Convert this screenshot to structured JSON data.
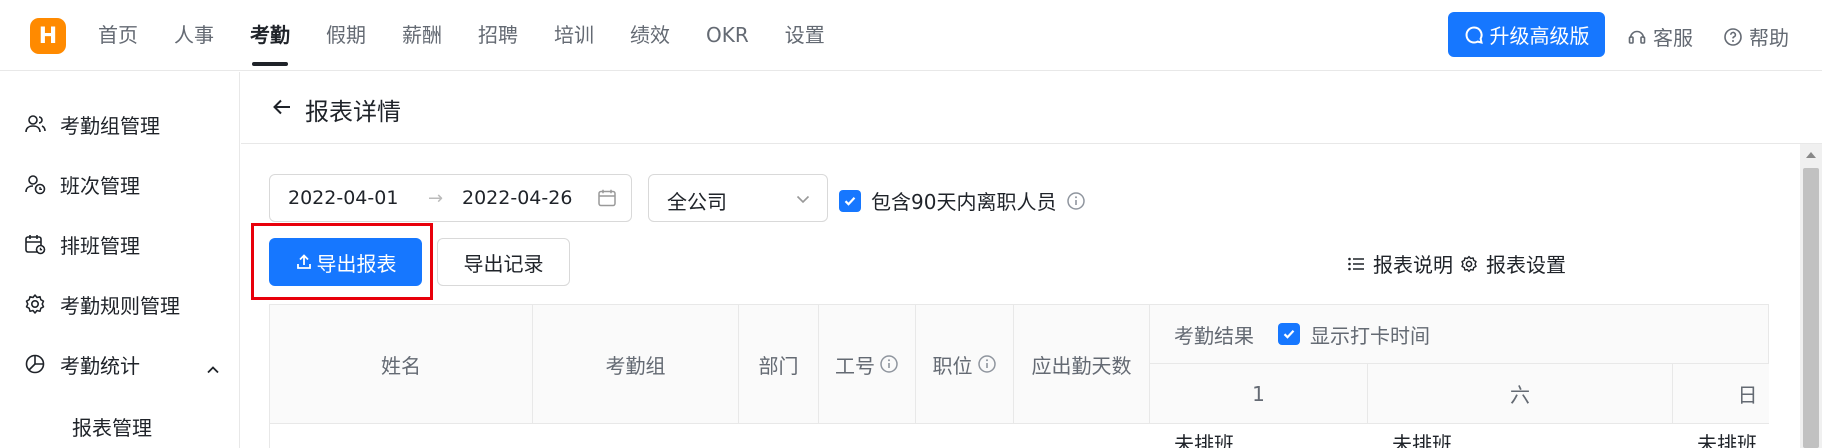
{
  "app": {
    "logo_letter": "H"
  },
  "nav": {
    "items": [
      {
        "label": "首页",
        "active": false
      },
      {
        "label": "人事",
        "active": false
      },
      {
        "label": "考勤",
        "active": true
      },
      {
        "label": "假期",
        "active": false
      },
      {
        "label": "薪酬",
        "active": false
      },
      {
        "label": "招聘",
        "active": false
      },
      {
        "label": "培训",
        "active": false
      },
      {
        "label": "绩效",
        "active": false
      },
      {
        "label": "OKR",
        "active": false
      },
      {
        "label": "设置",
        "active": false
      }
    ],
    "upgrade_label": "升级高级版",
    "service_label": "客服",
    "help_label": "帮助"
  },
  "sidebar": {
    "items": [
      {
        "label": "考勤组管理",
        "icon": "user-group-icon"
      },
      {
        "label": "班次管理",
        "icon": "user-clock-icon"
      },
      {
        "label": "排班管理",
        "icon": "calendar-clock-icon"
      },
      {
        "label": "考勤规则管理",
        "icon": "gear-icon"
      },
      {
        "label": "考勤统计",
        "icon": "pie-chart-icon"
      }
    ],
    "sub_item": "报表管理"
  },
  "page": {
    "title": "报表详情",
    "date_start": "2022-04-01",
    "date_end": "2022-04-26",
    "date_separator": "→",
    "scope_select": "全公司",
    "include_resigned_label": "包含90天内离职人员",
    "export_label": "导出报表",
    "export_record_label": "导出记录",
    "report_desc_label": "报表说明",
    "report_settings_label": "报表设置"
  },
  "table": {
    "headers": {
      "name": "姓名",
      "group": "考勤组",
      "dept": "部门",
      "emp_no": "工号",
      "position": "职位",
      "due_days": "应出勤天数",
      "result": "考勤结果",
      "show_punch": "显示打卡时间"
    },
    "days": [
      "1",
      "六",
      "日"
    ],
    "row_values": [
      "未排班",
      "未排班",
      "未排班"
    ]
  },
  "colors": {
    "primary": "#1677ff",
    "logo": "#ff8a00",
    "highlight": "#e8000b"
  }
}
